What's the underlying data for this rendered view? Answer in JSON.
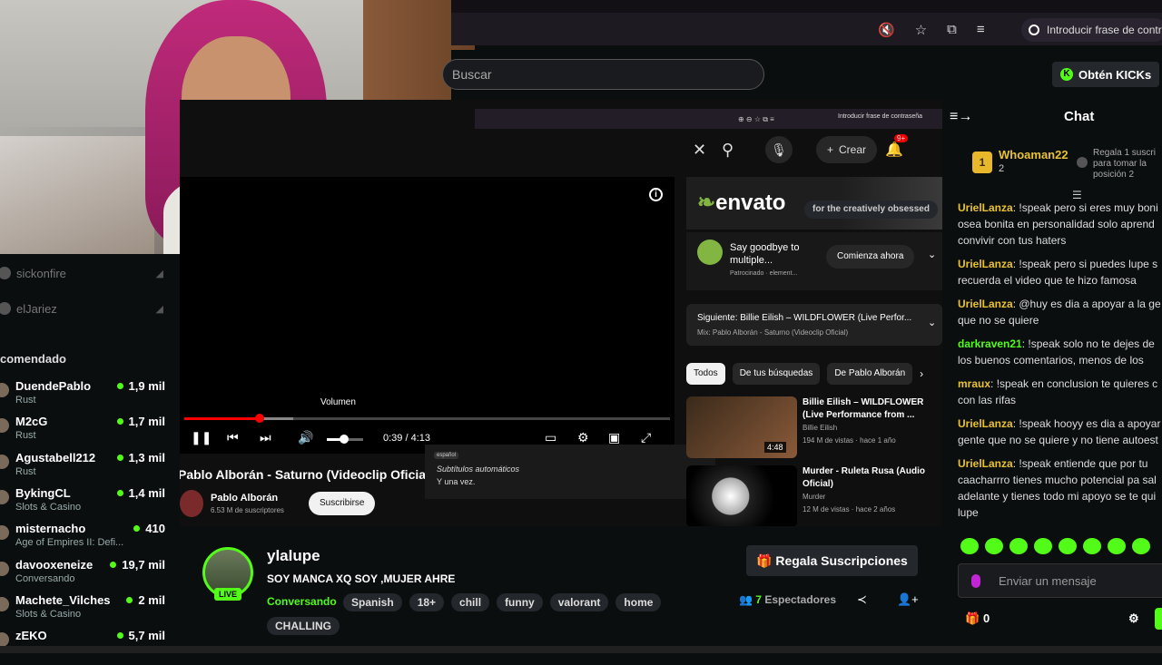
{
  "browser": {
    "password_prompt": "Introducir frase de contraseña",
    "icons": [
      "mute-tab-icon",
      "star-icon",
      "extensions-icon",
      "media-icon"
    ]
  },
  "header": {
    "search_placeholder": "Buscar",
    "kicks_button": "Obtén KICKs"
  },
  "sidebar": {
    "followed": [
      {
        "name": "sickonfire"
      },
      {
        "name": "elJariez"
      }
    ],
    "recommended_title": "comendado",
    "recommended": [
      {
        "name": "DuendePablo",
        "category": "Rust",
        "viewers": "1,9 mil"
      },
      {
        "name": "M2cG",
        "category": "Rust",
        "viewers": "1,7 mil"
      },
      {
        "name": "Agustabell212",
        "category": "Rust",
        "viewers": "1,3 mil"
      },
      {
        "name": "BykingCL",
        "category": "Slots & Casino",
        "viewers": "1,4 mil"
      },
      {
        "name": "misternacho",
        "category": "Age of Empires II: Defi...",
        "viewers": "410"
      },
      {
        "name": "davooxeneize",
        "category": "Conversando",
        "viewers": "19,7 mil"
      },
      {
        "name": "Machete_Vilches",
        "category": "Slots & Casino",
        "viewers": "2 mil"
      },
      {
        "name": "zEKO",
        "category": "",
        "viewers": "5,7 mil"
      }
    ]
  },
  "youtube": {
    "create_label": "Crear",
    "notif_count": "9+",
    "volume_tooltip": "Volumen",
    "time": "0:39 / 4:13",
    "progress_fraction": 0.155,
    "video_title": "Pablo Alborán - Saturno (Videoclip Oficial",
    "channel": "Pablo Alborán",
    "subscribers": "6.53 M de suscriptores",
    "subscribe": "Suscribirse",
    "cc_lang": "español",
    "cc_auto": "Subtítulos automáticos",
    "cc_once": "Y una vez.",
    "ad_brand_prefix": "",
    "ad_brand": "envato",
    "ad_tagline": "for the creatively obsessed",
    "ad_text": "Say goodbye to multiple...",
    "ad_sponsored": "Patrocinado · element...",
    "ad_button": "Comienza ahora",
    "next_line1": "Siguiente: Billie Eilish – WILDFLOWER (Live Perfor...",
    "next_line2": "Mix: Pablo Alborán - Saturno (Videoclip Oficial)",
    "chips": [
      "Todos",
      "De tus búsquedas",
      "De Pablo Alborán"
    ],
    "related": [
      {
        "title": "Billie Eilish – WILDFLOWER (Live Performance from ...",
        "channel": "Billie Eilish",
        "meta": "194 M de vistas · hace 1 año",
        "duration": "4:48"
      },
      {
        "title": "Murder - Ruleta Rusa (Audio Oficial)",
        "channel": "Murder",
        "meta": "12 M de vistas · hace 2 años",
        "duration": ""
      }
    ]
  },
  "chat": {
    "title": "Chat",
    "pinned_user": "Whoaman22",
    "pinned_count": "2",
    "pinned_gift": "Regala 1 suscri para tomar la posición 2",
    "messages": [
      {
        "user": "UrielLanza",
        "color": "#e8c232",
        "text": "!speak pero si eres muy boni osea bonita en personalidad solo aprend convivir con tus haters"
      },
      {
        "user": "UrielLanza",
        "color": "#e8c232",
        "text": "!speak pero si puedes lupe s recuerda el video que te hizo famosa"
      },
      {
        "user": "UrielLanza",
        "color": "#e8c232",
        "text": "@huy es dia a apoyar a la ge que no se quiere"
      },
      {
        "user": "darkraven21",
        "color": "#53fc18",
        "text": "!speak solo no te dejes de los buenos comentarios, menos de los"
      },
      {
        "user": "mraux",
        "color": "#e8c232",
        "text": "!speak en conclusion te quieres c con las rifas"
      },
      {
        "user": "UrielLanza",
        "color": "#e8c232",
        "text": "!speak hooyy es dia a apoyar gente que no se quiere y no tiene autoest"
      },
      {
        "user": "UrielLanza",
        "color": "#e8c232",
        "text": "!speak entiende que por tu caacharrro tienes mucho potencial pa sal adelante y tienes todo mi apoyo se te qui lupe"
      }
    ],
    "input_placeholder": "Enviar un mensaje",
    "kicks_count": "0"
  },
  "stream": {
    "live": "LIVE",
    "channel": "ylalupe",
    "title": "SOY MANCA XQ SOY ,MUJER AHRE",
    "category": "Conversando",
    "tags": [
      "Spanish",
      "18+",
      "chill",
      "funny",
      "valorant",
      "home"
    ],
    "tag2": "CHALLING",
    "gift_subs": "Regala Suscripciones",
    "viewers": "7",
    "viewers_label": "Espectadores"
  }
}
